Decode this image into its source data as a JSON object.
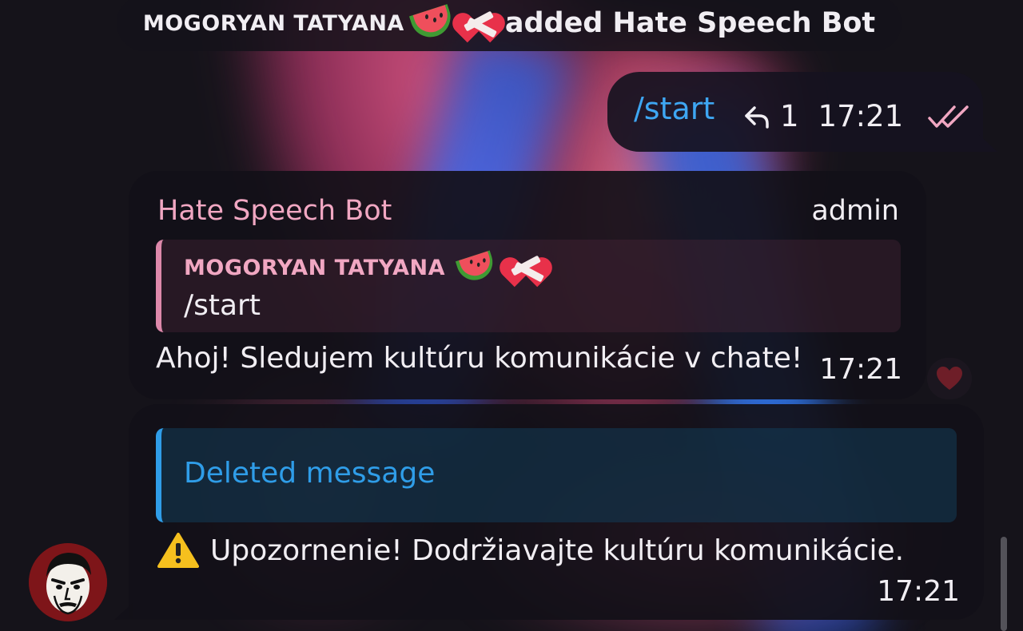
{
  "service_message": {
    "actor": "MOGORYAN TATYANA",
    "text": "added Hate Speech Bot"
  },
  "outgoing_message": {
    "text": "/start",
    "reply_count": "1",
    "time": "17:21",
    "read_status": "double-check-icon"
  },
  "bot_message": {
    "sender": "Hate Speech Bot",
    "role": "admin",
    "quote": {
      "author": "MOGORYAN TATYANA",
      "text": "/start"
    },
    "text": "Ahoj! Sledujem kultúru komunikácie v chate!",
    "time": "17:21",
    "reaction": "heart-icon"
  },
  "warning_message": {
    "quote_text": "Deleted message",
    "text": "Upozornenie! Dodržiavajte kultúru komunikácie.",
    "time": "17:21"
  },
  "colors": {
    "accent_blue": "#2f9de8",
    "sender_pink": "#f1a7c2",
    "quote_bar_pink": "#dd88aa"
  }
}
